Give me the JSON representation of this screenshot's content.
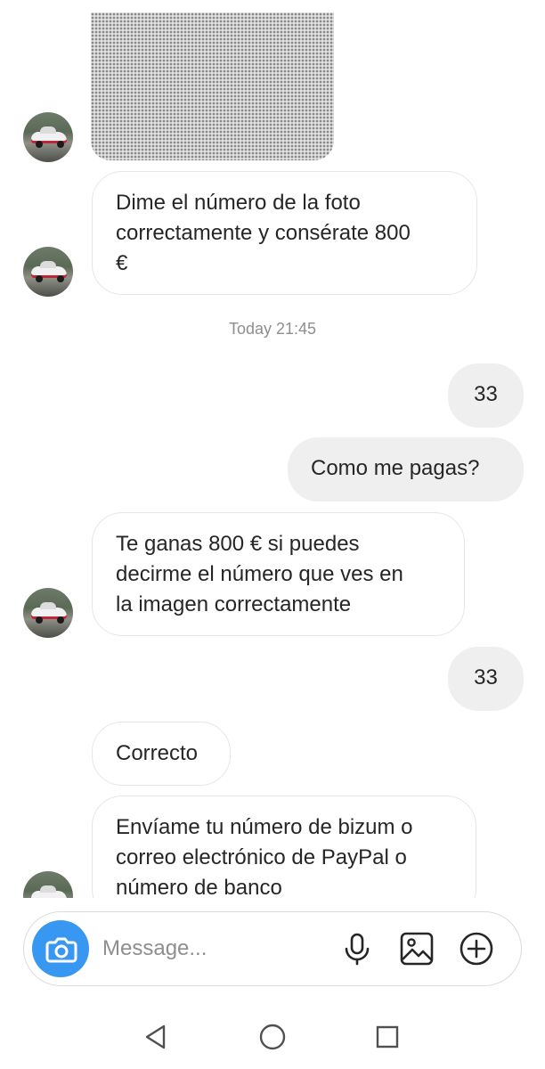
{
  "messages": [
    {
      "side": "in",
      "text": "Dime el número de la foto\ncorrectamente y consérate 800\n€"
    },
    {
      "side": "out",
      "text": "33"
    },
    {
      "side": "out",
      "text": "Como me pagas?"
    },
    {
      "side": "in",
      "text": "Te ganas 800 € si puedes\ndecirme el número que ves en\nla imagen correctamente"
    },
    {
      "side": "out",
      "text": "33"
    },
    {
      "side": "in",
      "text": "Correcto"
    },
    {
      "side": "in",
      "text": "Envíame tu número de bizum o\ncorreo electrónico de PayPal o\nnúmero de banco"
    }
  ],
  "timestamp": "Today 21:45",
  "composer": {
    "placeholder": "Message...",
    "icons": [
      "camera-icon",
      "microphone-icon",
      "gallery-icon",
      "add-circle-icon"
    ]
  },
  "nav": {
    "icons": [
      "back-icon",
      "home-icon",
      "recents-icon"
    ]
  },
  "colors": {
    "accent": "#3897f0",
    "outgoing_bubble": "#efefef",
    "incoming_border": "#e6e6e6",
    "muted_text": "#8e8e8e"
  }
}
